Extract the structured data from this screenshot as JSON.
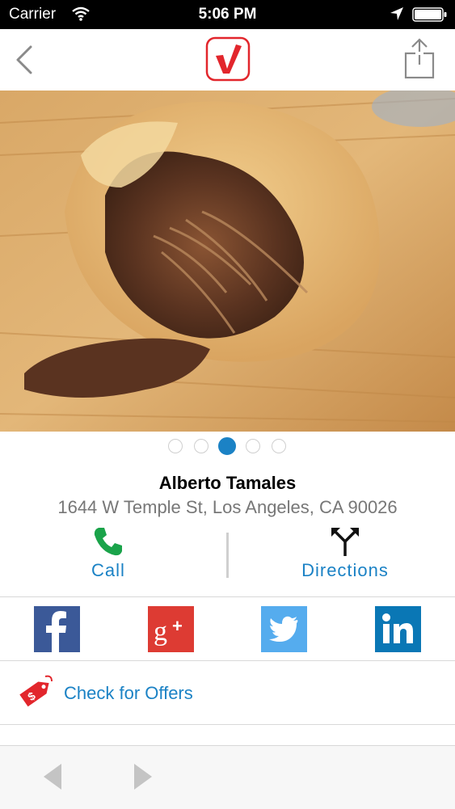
{
  "status_bar": {
    "carrier": "Carrier",
    "time": "5:06 PM"
  },
  "nav": {
    "back_icon": "chevron-left-icon",
    "logo_icon": "checkmark-logo-icon",
    "share_icon": "share-icon"
  },
  "hero": {
    "photo_subject": "tamale-photo",
    "page_count": 5,
    "active_page": 3
  },
  "business": {
    "name": "Alberto Tamales",
    "address": "1644 W Temple St, Los Angeles, CA 90026"
  },
  "actions": {
    "call_label": "Call",
    "directions_label": "Directions"
  },
  "social": [
    {
      "name": "facebook",
      "letter": "f",
      "color": "#3b5998"
    },
    {
      "name": "google-plus",
      "letter": "g+",
      "color": "#dd3b33"
    },
    {
      "name": "twitter",
      "letter": "",
      "color": "#55acee"
    },
    {
      "name": "linkedin",
      "letter": "in",
      "color": "#0a77b5"
    }
  ],
  "offers": {
    "label": "Check for Offers"
  },
  "colors": {
    "accent": "#1b82c5",
    "call_green": "#1aa34a",
    "brand_red": "#e2262c"
  }
}
